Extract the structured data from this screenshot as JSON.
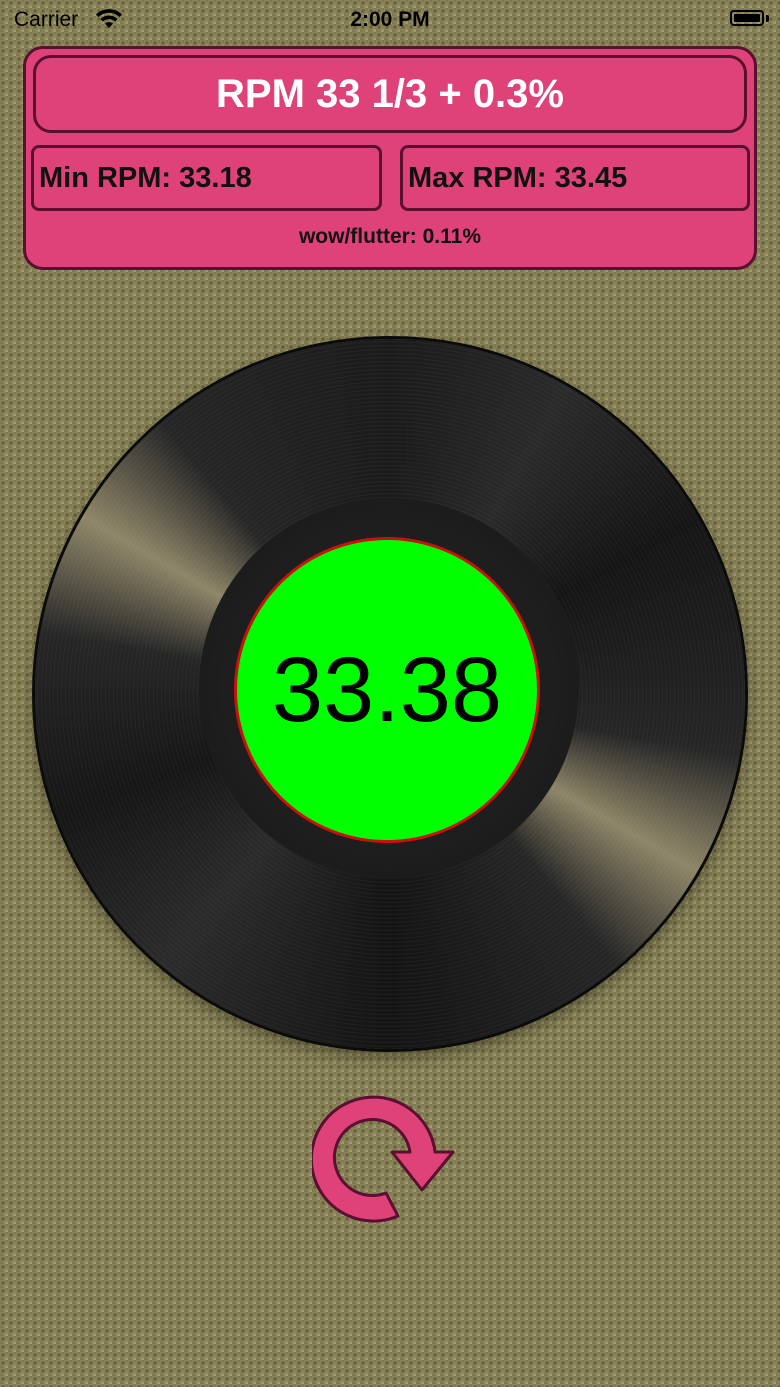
{
  "status_bar": {
    "carrier": "Carrier",
    "time": "2:00 PM",
    "wifi_icon": "wifi-icon",
    "battery_icon": "battery-icon"
  },
  "info_panel": {
    "rpm_title": "RPM 33 1/3 + 0.3%",
    "min_rpm": "Min RPM: 33.18",
    "max_rpm": "Max RPM: 33.45",
    "wow_flutter": "wow/flutter: 0.11%"
  },
  "record": {
    "current_rpm": "33.38",
    "label_color": "#00ff00",
    "label_border_color": "#cc1010"
  },
  "reset_button": {
    "icon": "reset-rotate-icon",
    "color": "#de4279"
  },
  "colors": {
    "panel": "#de4279",
    "panel_border": "#5a1030",
    "background": "#8a8458"
  }
}
